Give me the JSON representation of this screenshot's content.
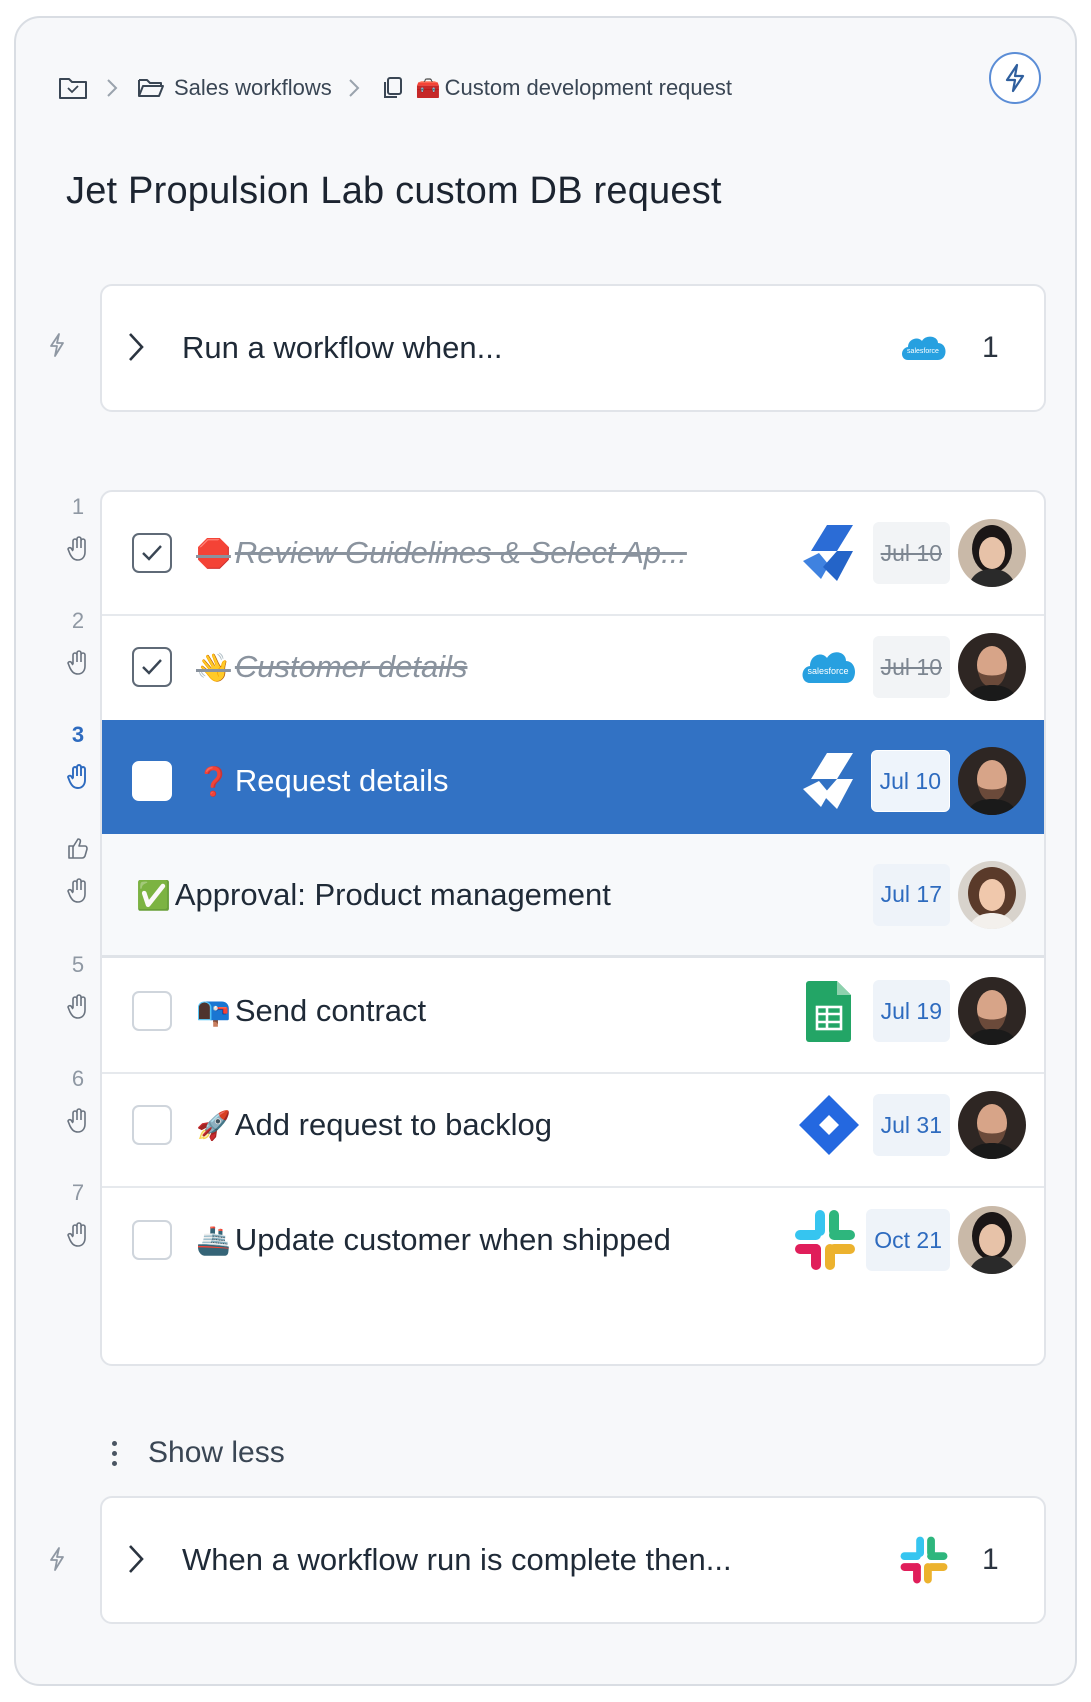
{
  "breadcrumb": {
    "root_icon": "folder-icon",
    "items": [
      {
        "label": "Sales workflows",
        "icon": "folder-open-icon"
      },
      {
        "label": "Custom development request",
        "icon": "copy-icon",
        "emoji": "🧰"
      }
    ]
  },
  "header": {
    "title": "Jet Propulsion Lab custom DB request",
    "action_icon": "lightning-icon"
  },
  "trigger_start": {
    "label": "Run a workflow when...",
    "app": "salesforce",
    "count": "1"
  },
  "steps": [
    {
      "num": "1",
      "emoji": "🛑",
      "label": "Review Guidelines & Select Ap...",
      "done": true,
      "app": "jira-service-management",
      "date": "Jul 10",
      "assignee": "woman-dark-hair"
    },
    {
      "num": "2",
      "emoji": "👋",
      "label": "Customer details",
      "done": true,
      "app": "salesforce",
      "date": "Jul 10",
      "assignee": "man-beard"
    },
    {
      "num": "3",
      "emoji": "❓",
      "label": "Request details",
      "done": false,
      "active": true,
      "app": "jira-service-management",
      "date": "Jul 10",
      "assignee": "man-beard"
    },
    {
      "num": "",
      "emoji": "✅",
      "label": "Approval: Product management",
      "approval": true,
      "date": "Jul 17",
      "assignee": "woman-curly-hair"
    },
    {
      "num": "5",
      "emoji": "📭",
      "label": "Send contract",
      "app": "google-sheets",
      "date": "Jul 19",
      "assignee": "man-beard"
    },
    {
      "num": "6",
      "emoji": "🚀",
      "label": "Add request to backlog",
      "app": "jira-software",
      "date": "Jul 31",
      "assignee": "man-beard"
    },
    {
      "num": "7",
      "emoji": "🚢",
      "label": "Update customer when shipped",
      "app": "slack",
      "date": "Oct 21",
      "assignee": "woman-dark-hair"
    }
  ],
  "show_less": {
    "label": "Show less"
  },
  "trigger_end": {
    "label": "When a workflow run is complete then...",
    "app": "slack",
    "count": "1"
  },
  "colors": {
    "accent": "#3272c4",
    "date_text": "#2e6bbf",
    "panel_bg": "#f7f8fa"
  }
}
